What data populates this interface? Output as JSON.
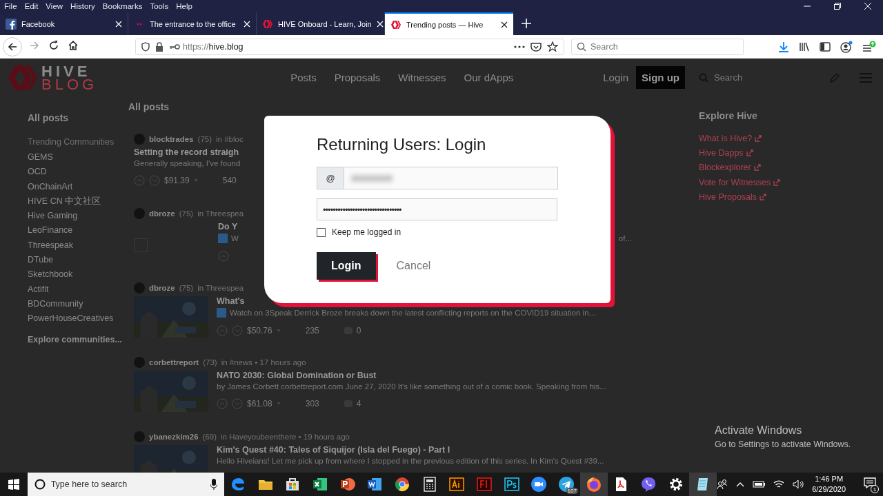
{
  "browser": {
    "menu": [
      "File",
      "Edit",
      "View",
      "History",
      "Bookmarks",
      "Tools",
      "Help"
    ],
    "tabs": [
      {
        "title": "Facebook",
        "selected": false
      },
      {
        "title": "The entrance to the office",
        "selected": false
      },
      {
        "title": "HIVE Onboard - Learn, Join",
        "selected": false
      },
      {
        "title": "Trending posts — Hive",
        "selected": true
      }
    ],
    "url_scheme": "https://",
    "url_host": "hive.blog",
    "search": {
      "placeholder": "Search"
    }
  },
  "site": {
    "logo": [
      "HIVE",
      "BLOG"
    ],
    "nav": [
      "Posts",
      "Proposals",
      "Witnesses",
      "Our dApps"
    ],
    "login": "Login",
    "signup": "Sign up",
    "search": {
      "placeholder": "Search"
    }
  },
  "sidebar": {
    "title": "All posts",
    "section": "Trending Communities",
    "items": [
      "GEMS",
      "OCD",
      "OnChainArt",
      "HIVE CN 中文社区",
      "Hive Gaming",
      "LeoFinance",
      "Threespeak",
      "DTube",
      "Sketchbook",
      "Actifit",
      "BDCommunity",
      "PowerHouseCreatives"
    ],
    "explore": "Explore communities..."
  },
  "feed": {
    "title": "All posts",
    "posts": [
      {
        "kind": "text",
        "author": "blocktrades",
        "rep": "(75)",
        "where": "in #bloc",
        "title": "Setting the record straigh",
        "excerpt": "Generally speaking, I've found",
        "video": false,
        "payout": "$91.39",
        "votes": "540"
      },
      {
        "kind": "broken_image",
        "author": "dbroze",
        "rep": "(75)",
        "where": "in Threespea",
        "title": "Do Y",
        "excerpt": "W",
        "excerpt_tail": "of...",
        "video": true
      },
      {
        "kind": "thumbnail",
        "author": "dbroze",
        "rep": "(75)",
        "where": "in Threespea",
        "title": "What's",
        "excerpt": "Watch on 3Speak Derrick Broze breaks down the latest conflicting reports on the COVID19 situation in...",
        "video": true,
        "payout": "$50.76",
        "votes": "235",
        "comments": "0"
      },
      {
        "kind": "thumbnail",
        "author": "corbettreport",
        "rep": "(73)",
        "where": "in #news • 17 hours ago",
        "title": "NATO 2030: Global Domination or Bust",
        "excerpt": "by James Corbett corbettreport.com June 27, 2020 It's like something out of a comic book. Speaking from his...",
        "video": false,
        "payout": "$61.08",
        "votes": "303",
        "comments": "4"
      },
      {
        "kind": "thumbnail",
        "author": "ybanezkim26",
        "rep": "(69)",
        "where": "in Haveyoubeenthere • 19 hours ago",
        "title": "Kim's Quest #40: Tales of Siquijor (Isla del Fuego) - Part I",
        "excerpt": "Hello Hiveians! Let me pick up from where I stopped in the previous edition of this series. In Kim's Quest #39...",
        "video": false
      }
    ]
  },
  "explore": {
    "title": "Explore Hive",
    "links": [
      "What is Hive?",
      "Hive Dapps",
      "Blockexplorer",
      "Vote for Witnesses",
      "Hive Proposals"
    ]
  },
  "modal": {
    "title": "Returning Users: Login",
    "prefix": "@",
    "password": "••••••••••••••••••••••••••••••••",
    "remember": {
      "label": "Keep me logged in",
      "checked": false
    },
    "submit": "Login",
    "cancel": "Cancel"
  },
  "watermark": {
    "title": "Activate Windows",
    "text": "Go to Settings to activate Windows."
  },
  "taskbar": {
    "search": {
      "placeholder": "Type here to search"
    },
    "apps": [
      {
        "active": false
      },
      {
        "active": false
      },
      {
        "active": false
      },
      {
        "active": false
      },
      {
        "active": false
      },
      {
        "active": false
      },
      {
        "active": false
      },
      {
        "active": false
      },
      {
        "active": false
      },
      {
        "active": false
      },
      {
        "active": false
      },
      {
        "active": false
      },
      {
        "active": false,
        "badge": "107"
      },
      {
        "active": true
      },
      {
        "active": false
      },
      {
        "active": false
      },
      {
        "active": false
      },
      {
        "active": true
      }
    ],
    "time": "1:46 PM",
    "date": "6/29/2020",
    "notifications": "1"
  }
}
